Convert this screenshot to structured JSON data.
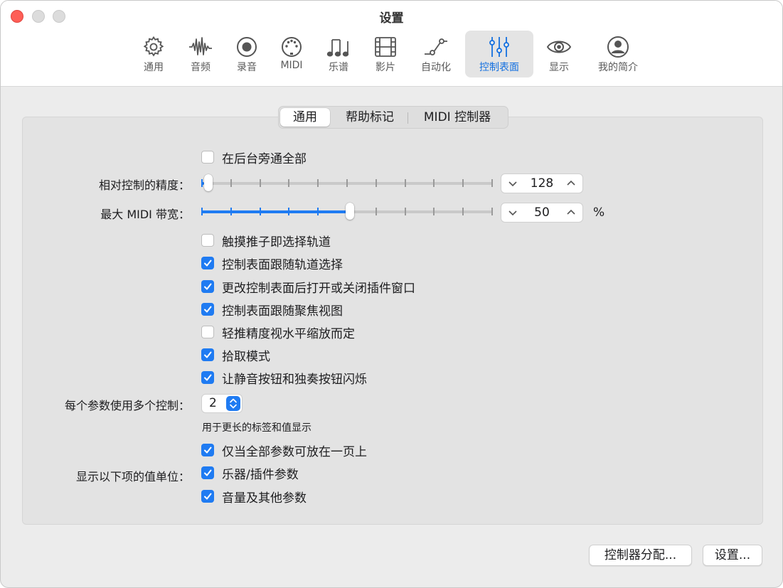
{
  "window": {
    "title": "设置"
  },
  "toolbar": {
    "items": [
      {
        "label": "通用",
        "icon": "gear-icon"
      },
      {
        "label": "音频",
        "icon": "waveform-icon"
      },
      {
        "label": "录音",
        "icon": "record-icon"
      },
      {
        "label": "MIDI",
        "icon": "midi-connector-icon"
      },
      {
        "label": "乐谱",
        "icon": "music-notes-icon"
      },
      {
        "label": "影片",
        "icon": "film-icon"
      },
      {
        "label": "自动化",
        "icon": "automation-curve-icon"
      },
      {
        "label": "控制表面",
        "icon": "sliders-icon",
        "active": true
      },
      {
        "label": "显示",
        "icon": "eye-icon"
      },
      {
        "label": "我的简介",
        "icon": "person-icon"
      }
    ]
  },
  "tabs": {
    "items": [
      {
        "label": "通用",
        "selected": true
      },
      {
        "label": "帮助标记"
      },
      {
        "label": "MIDI 控制器"
      }
    ]
  },
  "settings": {
    "bypass_all": {
      "label": "在后台旁通全部",
      "checked": false
    },
    "relative_precision": {
      "label": "相对控制的精度：",
      "value": "128",
      "level_fraction": 0.0
    },
    "max_midi_bandwidth": {
      "label": "最大 MIDI 带宽：",
      "value": "50",
      "unit": "%",
      "level_fraction": 0.5
    },
    "checkboxes": [
      {
        "label": "触摸推子即选择轨道",
        "checked": false
      },
      {
        "label": "控制表面跟随轨道选择",
        "checked": true
      },
      {
        "label": "更改控制表面后打开或关闭插件窗口",
        "checked": true
      },
      {
        "label": "控制表面跟随聚焦视图",
        "checked": true
      },
      {
        "label": "轻推精度视水平缩放而定",
        "checked": false
      },
      {
        "label": "拾取模式",
        "checked": true
      },
      {
        "label": "让静音按钮和独奏按钮闪烁",
        "checked": true
      }
    ],
    "multi_control": {
      "label": "每个参数使用多个控制：",
      "value": "2",
      "note": "用于更长的标签和值显示"
    },
    "value_units": {
      "label": "显示以下项的值单位：",
      "items": [
        {
          "label": "仅当全部参数可放在一页上",
          "checked": true
        },
        {
          "label": "乐器/插件参数",
          "checked": true
        },
        {
          "label": "音量及其他参数",
          "checked": true
        }
      ]
    }
  },
  "buttons": {
    "assignments": "控制器分配...",
    "setup": "设置..."
  },
  "colors": {
    "accent": "#1f7bf2",
    "active_label": "#1470e0",
    "close": "#fe5f57"
  }
}
